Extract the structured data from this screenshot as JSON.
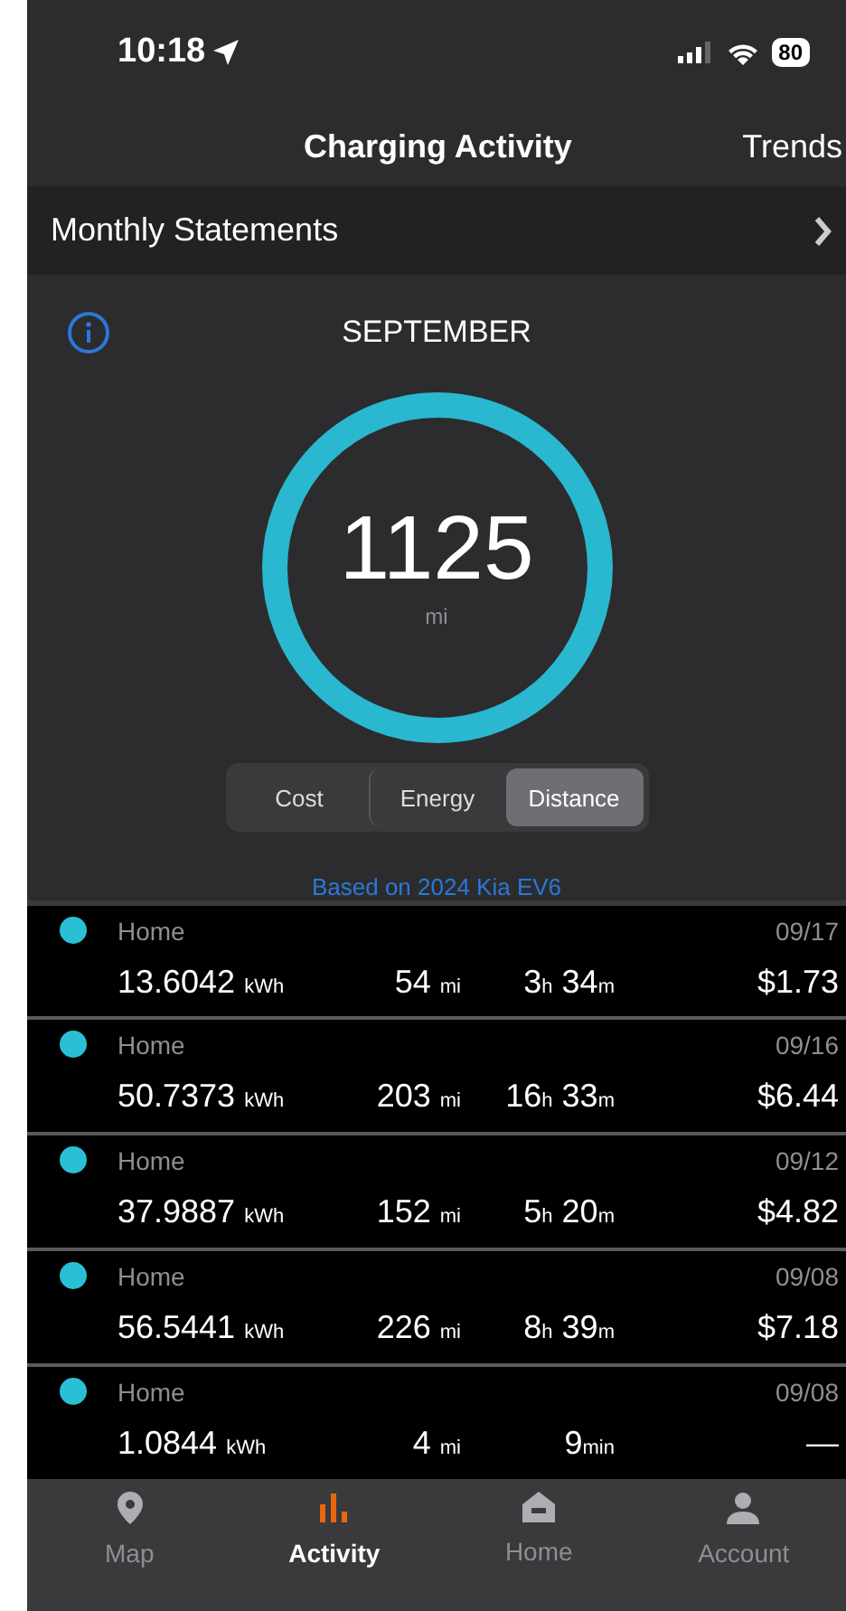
{
  "status_bar": {
    "time": "10:18",
    "battery": "80"
  },
  "header": {
    "title": "Charging Activity",
    "trends": "Trends"
  },
  "statements": {
    "label": "Monthly Statements"
  },
  "summary": {
    "month": "SEPTEMBER",
    "value": "1125",
    "unit": "mi"
  },
  "segments": [
    {
      "label": "Cost",
      "selected": false
    },
    {
      "label": "Energy",
      "selected": false
    },
    {
      "label": "Distance",
      "selected": true
    }
  ],
  "note": "Based on 2024 Kia EV6",
  "sessions": [
    {
      "location": "Home",
      "color": "#29c0d6",
      "date": "09/17",
      "energy": {
        "value": "13.6042",
        "unit": "kWh"
      },
      "distance": {
        "value": "54",
        "unit": "mi"
      },
      "duration": [
        {
          "value": "3",
          "unit": "h"
        },
        {
          "value": "34",
          "unit": "m"
        }
      ],
      "cost": "$1.73"
    },
    {
      "location": "Home",
      "color": "#29c0d6",
      "date": "09/16",
      "energy": {
        "value": "50.7373",
        "unit": "kWh"
      },
      "distance": {
        "value": "203",
        "unit": "mi"
      },
      "duration": [
        {
          "value": "16",
          "unit": "h"
        },
        {
          "value": "33",
          "unit": "m"
        }
      ],
      "cost": "$6.44"
    },
    {
      "location": "Home",
      "color": "#29c0d6",
      "date": "09/12",
      "energy": {
        "value": "37.9887",
        "unit": "kWh"
      },
      "distance": {
        "value": "152",
        "unit": "mi"
      },
      "duration": [
        {
          "value": "5",
          "unit": "h"
        },
        {
          "value": "20",
          "unit": "m"
        }
      ],
      "cost": "$4.82"
    },
    {
      "location": "Home",
      "color": "#29c0d6",
      "date": "09/08",
      "energy": {
        "value": "56.5441",
        "unit": "kWh"
      },
      "distance": {
        "value": "226",
        "unit": "mi"
      },
      "duration": [
        {
          "value": "8",
          "unit": "h"
        },
        {
          "value": "39",
          "unit": "m"
        }
      ],
      "cost": "$7.18"
    },
    {
      "location": "Home",
      "color": "#29c0d6",
      "date": "09/08",
      "energy": {
        "value": "1.0844",
        "unit": "kWh"
      },
      "distance": {
        "value": "4",
        "unit": "mi"
      },
      "duration": [
        {
          "value": "9",
          "unit": "min"
        }
      ],
      "cost": "—"
    }
  ],
  "tab_bar": [
    {
      "kind": "map",
      "label": "Map",
      "selected": false
    },
    {
      "kind": "activity",
      "label": "Activity",
      "selected": true
    },
    {
      "kind": "home",
      "label": "Home",
      "selected": false
    },
    {
      "kind": "account",
      "label": "Account",
      "selected": false
    }
  ]
}
